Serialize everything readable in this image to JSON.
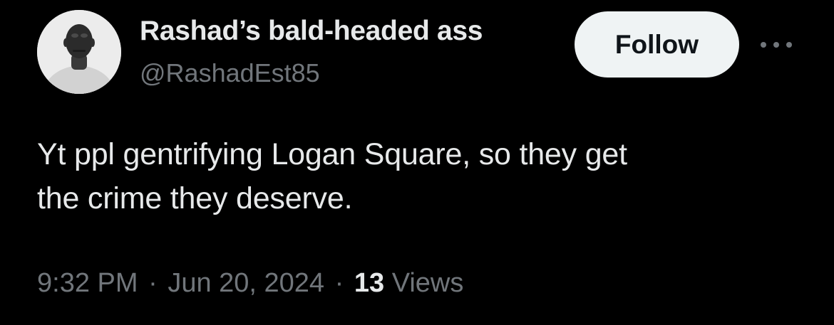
{
  "author": {
    "display_name": "Rashad’s bald-headed ass",
    "handle": "@RashadEst85"
  },
  "actions": {
    "follow_label": "Follow",
    "more_icon": "more-options-icon"
  },
  "tweet": {
    "text_lines": [
      "Yt ppl gentrifying Logan Square, so they get",
      "the crime they deserve."
    ]
  },
  "meta": {
    "time": "9:32 PM",
    "separator": "·",
    "date": "Jun 20, 2024",
    "views_count": "13",
    "views_label": "Views"
  },
  "colors": {
    "background": "#000000",
    "primary_text": "#e7e9ea",
    "secondary_text": "#71767b",
    "follow_button_bg": "#eff3f4",
    "follow_button_text": "#0f1419"
  }
}
